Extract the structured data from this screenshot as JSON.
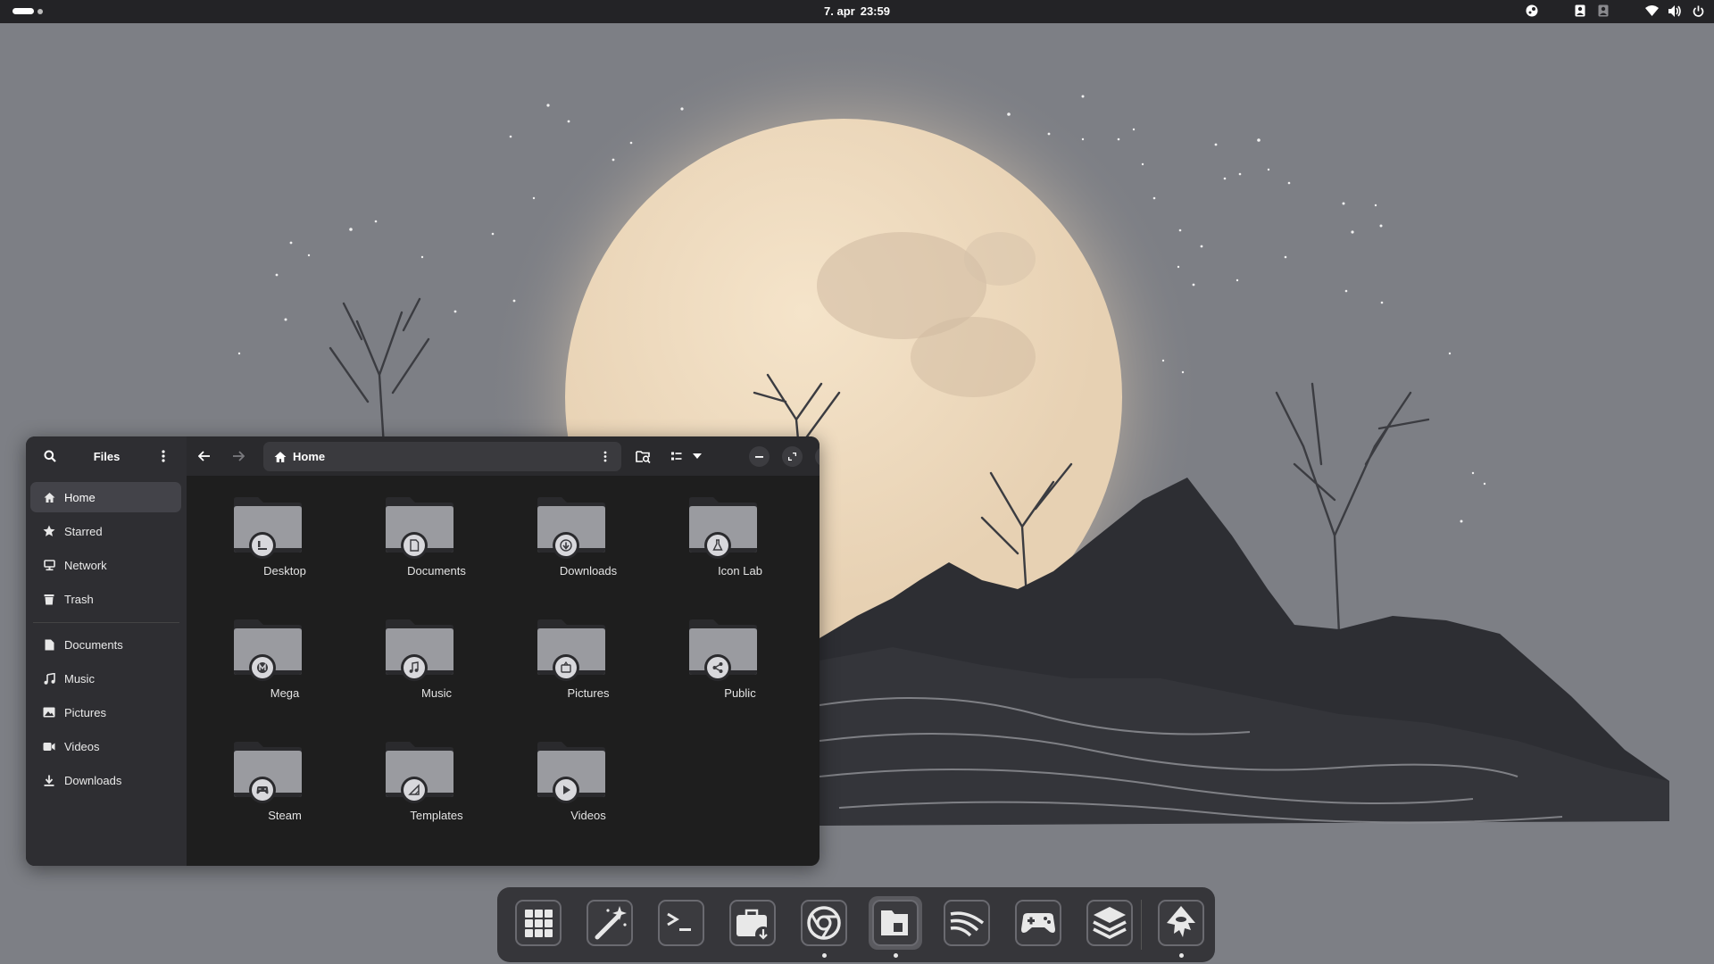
{
  "topbar": {
    "date": "7. apr",
    "time": "23:59",
    "tray_icons": [
      "steam-icon",
      "user-switch-icon",
      "user-secondary-icon",
      "wifi-icon",
      "volume-icon",
      "power-icon"
    ]
  },
  "window": {
    "sidebar_title": "Files",
    "places": [
      {
        "label": "Home",
        "icon": "home-icon",
        "active": true
      },
      {
        "label": "Starred",
        "icon": "star-icon"
      },
      {
        "label": "Network",
        "icon": "network-icon"
      },
      {
        "label": "Trash",
        "icon": "trash-icon"
      }
    ],
    "bookmarks": [
      {
        "label": "Documents",
        "icon": "document-icon"
      },
      {
        "label": "Music",
        "icon": "music-icon"
      },
      {
        "label": "Pictures",
        "icon": "pictures-icon"
      },
      {
        "label": "Videos",
        "icon": "video-icon"
      },
      {
        "label": "Downloads",
        "icon": "download-icon"
      }
    ],
    "path": "Home",
    "folders": [
      {
        "label": "Desktop",
        "emblem": "desktop-icon"
      },
      {
        "label": "Documents",
        "emblem": "document-icon"
      },
      {
        "label": "Downloads",
        "emblem": "download-icon"
      },
      {
        "label": "Icon Lab",
        "emblem": "flask-icon"
      },
      {
        "label": "Mega",
        "emblem": "mega-icon"
      },
      {
        "label": "Music",
        "emblem": "music-icon"
      },
      {
        "label": "Pictures",
        "emblem": "pictures-icon"
      },
      {
        "label": "Public",
        "emblem": "share-icon"
      },
      {
        "label": "Steam",
        "emblem": "gamepad-icon"
      },
      {
        "label": "Templates",
        "emblem": "template-icon"
      },
      {
        "label": "Videos",
        "emblem": "play-icon"
      }
    ]
  },
  "dock": {
    "apps": [
      {
        "name": "app-grid",
        "icon": "app-grid-icon",
        "running": false
      },
      {
        "name": "magic-wand-app",
        "icon": "magic-wand-icon",
        "running": false
      },
      {
        "name": "terminal",
        "icon": "terminal-icon",
        "running": false
      },
      {
        "name": "software-store",
        "icon": "briefcase-download-icon",
        "running": false
      },
      {
        "name": "chromium",
        "icon": "chrome-icon",
        "running": true
      },
      {
        "name": "files",
        "icon": "folder-icon",
        "running": true,
        "active": true
      },
      {
        "name": "rss-reader",
        "icon": "rss-icon",
        "running": false
      },
      {
        "name": "games",
        "icon": "gamepad-icon",
        "running": false
      },
      {
        "name": "layers-app",
        "icon": "layers-icon",
        "running": false
      },
      {
        "name": "inkscape",
        "icon": "inkscape-icon",
        "running": true
      }
    ]
  },
  "colors": {
    "wallpaper_sky": "#7d7f85",
    "moon": "#f0dcc0",
    "mountains": "#2d2e33",
    "panel": "#232326",
    "window_bg": "#1e1e1e",
    "sidebar_bg": "#2e2e32"
  }
}
